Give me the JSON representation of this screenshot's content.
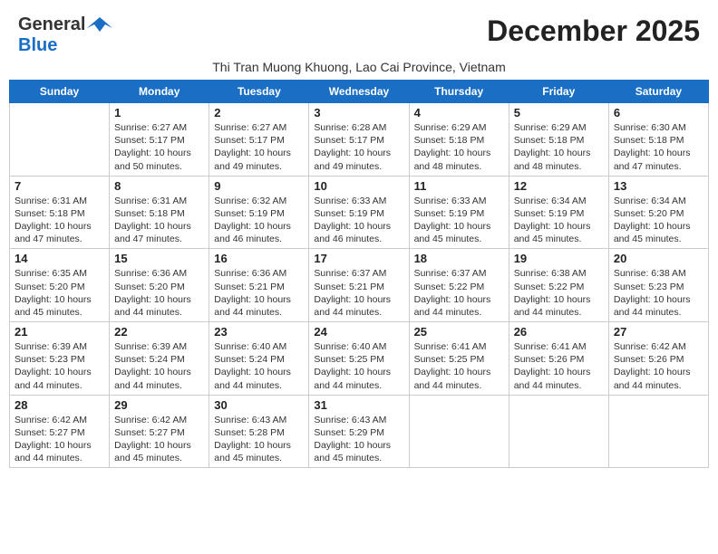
{
  "header": {
    "logo_general": "General",
    "logo_blue": "Blue",
    "month_title": "December 2025",
    "subtitle": "Thi Tran Muong Khuong, Lao Cai Province, Vietnam"
  },
  "days_of_week": [
    "Sunday",
    "Monday",
    "Tuesday",
    "Wednesday",
    "Thursday",
    "Friday",
    "Saturday"
  ],
  "weeks": [
    [
      {
        "day": "",
        "info": ""
      },
      {
        "day": "1",
        "info": "Sunrise: 6:27 AM\nSunset: 5:17 PM\nDaylight: 10 hours\nand 50 minutes."
      },
      {
        "day": "2",
        "info": "Sunrise: 6:27 AM\nSunset: 5:17 PM\nDaylight: 10 hours\nand 49 minutes."
      },
      {
        "day": "3",
        "info": "Sunrise: 6:28 AM\nSunset: 5:17 PM\nDaylight: 10 hours\nand 49 minutes."
      },
      {
        "day": "4",
        "info": "Sunrise: 6:29 AM\nSunset: 5:18 PM\nDaylight: 10 hours\nand 48 minutes."
      },
      {
        "day": "5",
        "info": "Sunrise: 6:29 AM\nSunset: 5:18 PM\nDaylight: 10 hours\nand 48 minutes."
      },
      {
        "day": "6",
        "info": "Sunrise: 6:30 AM\nSunset: 5:18 PM\nDaylight: 10 hours\nand 47 minutes."
      }
    ],
    [
      {
        "day": "7",
        "info": "Sunrise: 6:31 AM\nSunset: 5:18 PM\nDaylight: 10 hours\nand 47 minutes."
      },
      {
        "day": "8",
        "info": "Sunrise: 6:31 AM\nSunset: 5:18 PM\nDaylight: 10 hours\nand 47 minutes."
      },
      {
        "day": "9",
        "info": "Sunrise: 6:32 AM\nSunset: 5:19 PM\nDaylight: 10 hours\nand 46 minutes."
      },
      {
        "day": "10",
        "info": "Sunrise: 6:33 AM\nSunset: 5:19 PM\nDaylight: 10 hours\nand 46 minutes."
      },
      {
        "day": "11",
        "info": "Sunrise: 6:33 AM\nSunset: 5:19 PM\nDaylight: 10 hours\nand 45 minutes."
      },
      {
        "day": "12",
        "info": "Sunrise: 6:34 AM\nSunset: 5:19 PM\nDaylight: 10 hours\nand 45 minutes."
      },
      {
        "day": "13",
        "info": "Sunrise: 6:34 AM\nSunset: 5:20 PM\nDaylight: 10 hours\nand 45 minutes."
      }
    ],
    [
      {
        "day": "14",
        "info": "Sunrise: 6:35 AM\nSunset: 5:20 PM\nDaylight: 10 hours\nand 45 minutes."
      },
      {
        "day": "15",
        "info": "Sunrise: 6:36 AM\nSunset: 5:20 PM\nDaylight: 10 hours\nand 44 minutes."
      },
      {
        "day": "16",
        "info": "Sunrise: 6:36 AM\nSunset: 5:21 PM\nDaylight: 10 hours\nand 44 minutes."
      },
      {
        "day": "17",
        "info": "Sunrise: 6:37 AM\nSunset: 5:21 PM\nDaylight: 10 hours\nand 44 minutes."
      },
      {
        "day": "18",
        "info": "Sunrise: 6:37 AM\nSunset: 5:22 PM\nDaylight: 10 hours\nand 44 minutes."
      },
      {
        "day": "19",
        "info": "Sunrise: 6:38 AM\nSunset: 5:22 PM\nDaylight: 10 hours\nand 44 minutes."
      },
      {
        "day": "20",
        "info": "Sunrise: 6:38 AM\nSunset: 5:23 PM\nDaylight: 10 hours\nand 44 minutes."
      }
    ],
    [
      {
        "day": "21",
        "info": "Sunrise: 6:39 AM\nSunset: 5:23 PM\nDaylight: 10 hours\nand 44 minutes."
      },
      {
        "day": "22",
        "info": "Sunrise: 6:39 AM\nSunset: 5:24 PM\nDaylight: 10 hours\nand 44 minutes."
      },
      {
        "day": "23",
        "info": "Sunrise: 6:40 AM\nSunset: 5:24 PM\nDaylight: 10 hours\nand 44 minutes."
      },
      {
        "day": "24",
        "info": "Sunrise: 6:40 AM\nSunset: 5:25 PM\nDaylight: 10 hours\nand 44 minutes."
      },
      {
        "day": "25",
        "info": "Sunrise: 6:41 AM\nSunset: 5:25 PM\nDaylight: 10 hours\nand 44 minutes."
      },
      {
        "day": "26",
        "info": "Sunrise: 6:41 AM\nSunset: 5:26 PM\nDaylight: 10 hours\nand 44 minutes."
      },
      {
        "day": "27",
        "info": "Sunrise: 6:42 AM\nSunset: 5:26 PM\nDaylight: 10 hours\nand 44 minutes."
      }
    ],
    [
      {
        "day": "28",
        "info": "Sunrise: 6:42 AM\nSunset: 5:27 PM\nDaylight: 10 hours\nand 44 minutes."
      },
      {
        "day": "29",
        "info": "Sunrise: 6:42 AM\nSunset: 5:27 PM\nDaylight: 10 hours\nand 45 minutes."
      },
      {
        "day": "30",
        "info": "Sunrise: 6:43 AM\nSunset: 5:28 PM\nDaylight: 10 hours\nand 45 minutes."
      },
      {
        "day": "31",
        "info": "Sunrise: 6:43 AM\nSunset: 5:29 PM\nDaylight: 10 hours\nand 45 minutes."
      },
      {
        "day": "",
        "info": ""
      },
      {
        "day": "",
        "info": ""
      },
      {
        "day": "",
        "info": ""
      }
    ]
  ]
}
